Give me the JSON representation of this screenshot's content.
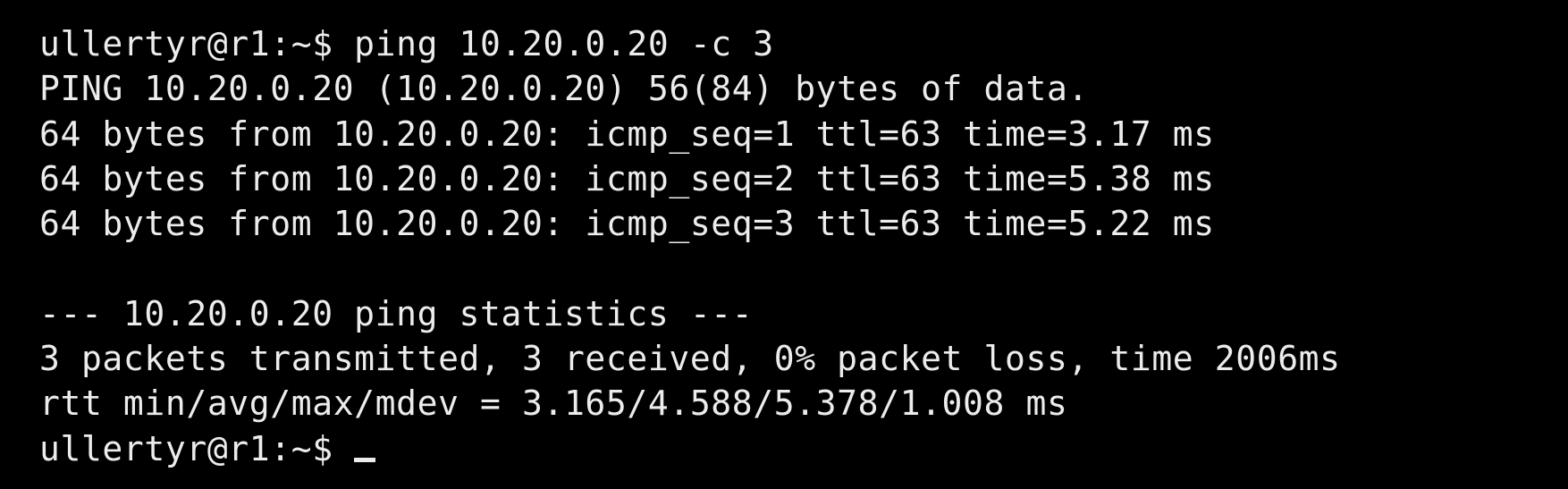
{
  "terminal": {
    "lines": [
      "ullertyr@r1:~$ ping 10.20.0.20 -c 3",
      "PING 10.20.0.20 (10.20.0.20) 56(84) bytes of data.",
      "64 bytes from 10.20.0.20: icmp_seq=1 ttl=63 time=3.17 ms",
      "64 bytes from 10.20.0.20: icmp_seq=2 ttl=63 time=5.38 ms",
      "64 bytes from 10.20.0.20: icmp_seq=3 ttl=63 time=5.22 ms",
      "",
      "--- 10.20.0.20 ping statistics ---",
      "3 packets transmitted, 3 received, 0% packet loss, time 2006ms",
      "rtt min/avg/max/mdev = 3.165/4.588/5.378/1.008 ms"
    ],
    "prompt": "ullertyr@r1:~$ ",
    "colors": {
      "background": "#000000",
      "foreground": "#ececec"
    }
  }
}
